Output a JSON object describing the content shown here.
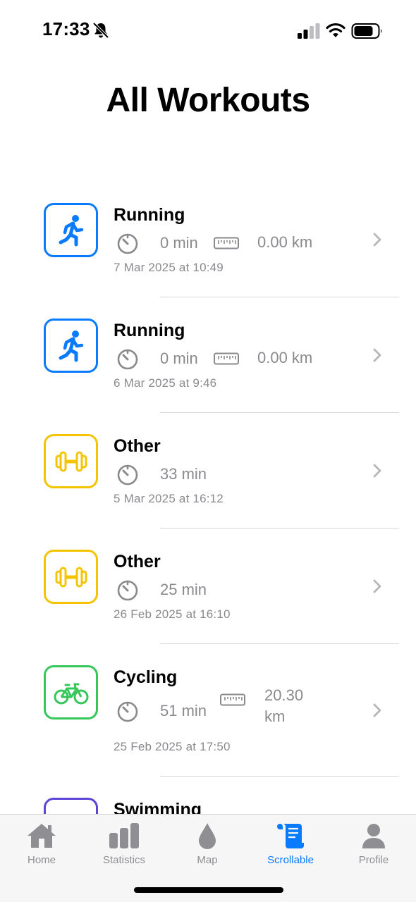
{
  "status_bar": {
    "time": "17:33",
    "icons": [
      "bell-slash-icon",
      "signal-icon",
      "wifi-icon",
      "battery-icon"
    ]
  },
  "page": {
    "title": "All Workouts"
  },
  "colors": {
    "running": "#0a7aff",
    "other": "#f5c400",
    "cycling": "#34c759",
    "swimming": "#5e45d6",
    "tab_active": "#0a7aff",
    "tab_inactive": "#8e8e93",
    "secondary_text": "#8a8a8e"
  },
  "workouts": [
    {
      "name": "Running",
      "icon": "running-icon",
      "duration": "0 min",
      "distance": "0.00 km",
      "date": "7 Mar 2025 at 10:49"
    },
    {
      "name": "Running",
      "icon": "running-icon",
      "duration": "0 min",
      "distance": "0.00 km",
      "date": "6 Mar 2025 at 9:46"
    },
    {
      "name": "Other",
      "icon": "dumbbell-icon",
      "duration": "33 min",
      "date": "5 Mar 2025 at 16:12"
    },
    {
      "name": "Other",
      "icon": "dumbbell-icon",
      "duration": "25 min",
      "date": "26 Feb 2025 at 16:10"
    },
    {
      "name": "Cycling",
      "icon": "bicycle-icon",
      "duration": "51 min",
      "distance": "20.30 km",
      "date": "25 Feb 2025 at 17:50"
    },
    {
      "name": "Swimming",
      "icon": "swimming-icon"
    }
  ],
  "tab_bar": {
    "tabs": [
      {
        "label": "Home",
        "icon": "house-icon"
      },
      {
        "label": "Statistics",
        "icon": "bar-chart-icon"
      },
      {
        "label": "Map",
        "icon": "drop-icon"
      },
      {
        "label": "Scrollable",
        "icon": "scroll-icon",
        "active": true
      },
      {
        "label": "Profile",
        "icon": "person-icon"
      }
    ]
  }
}
